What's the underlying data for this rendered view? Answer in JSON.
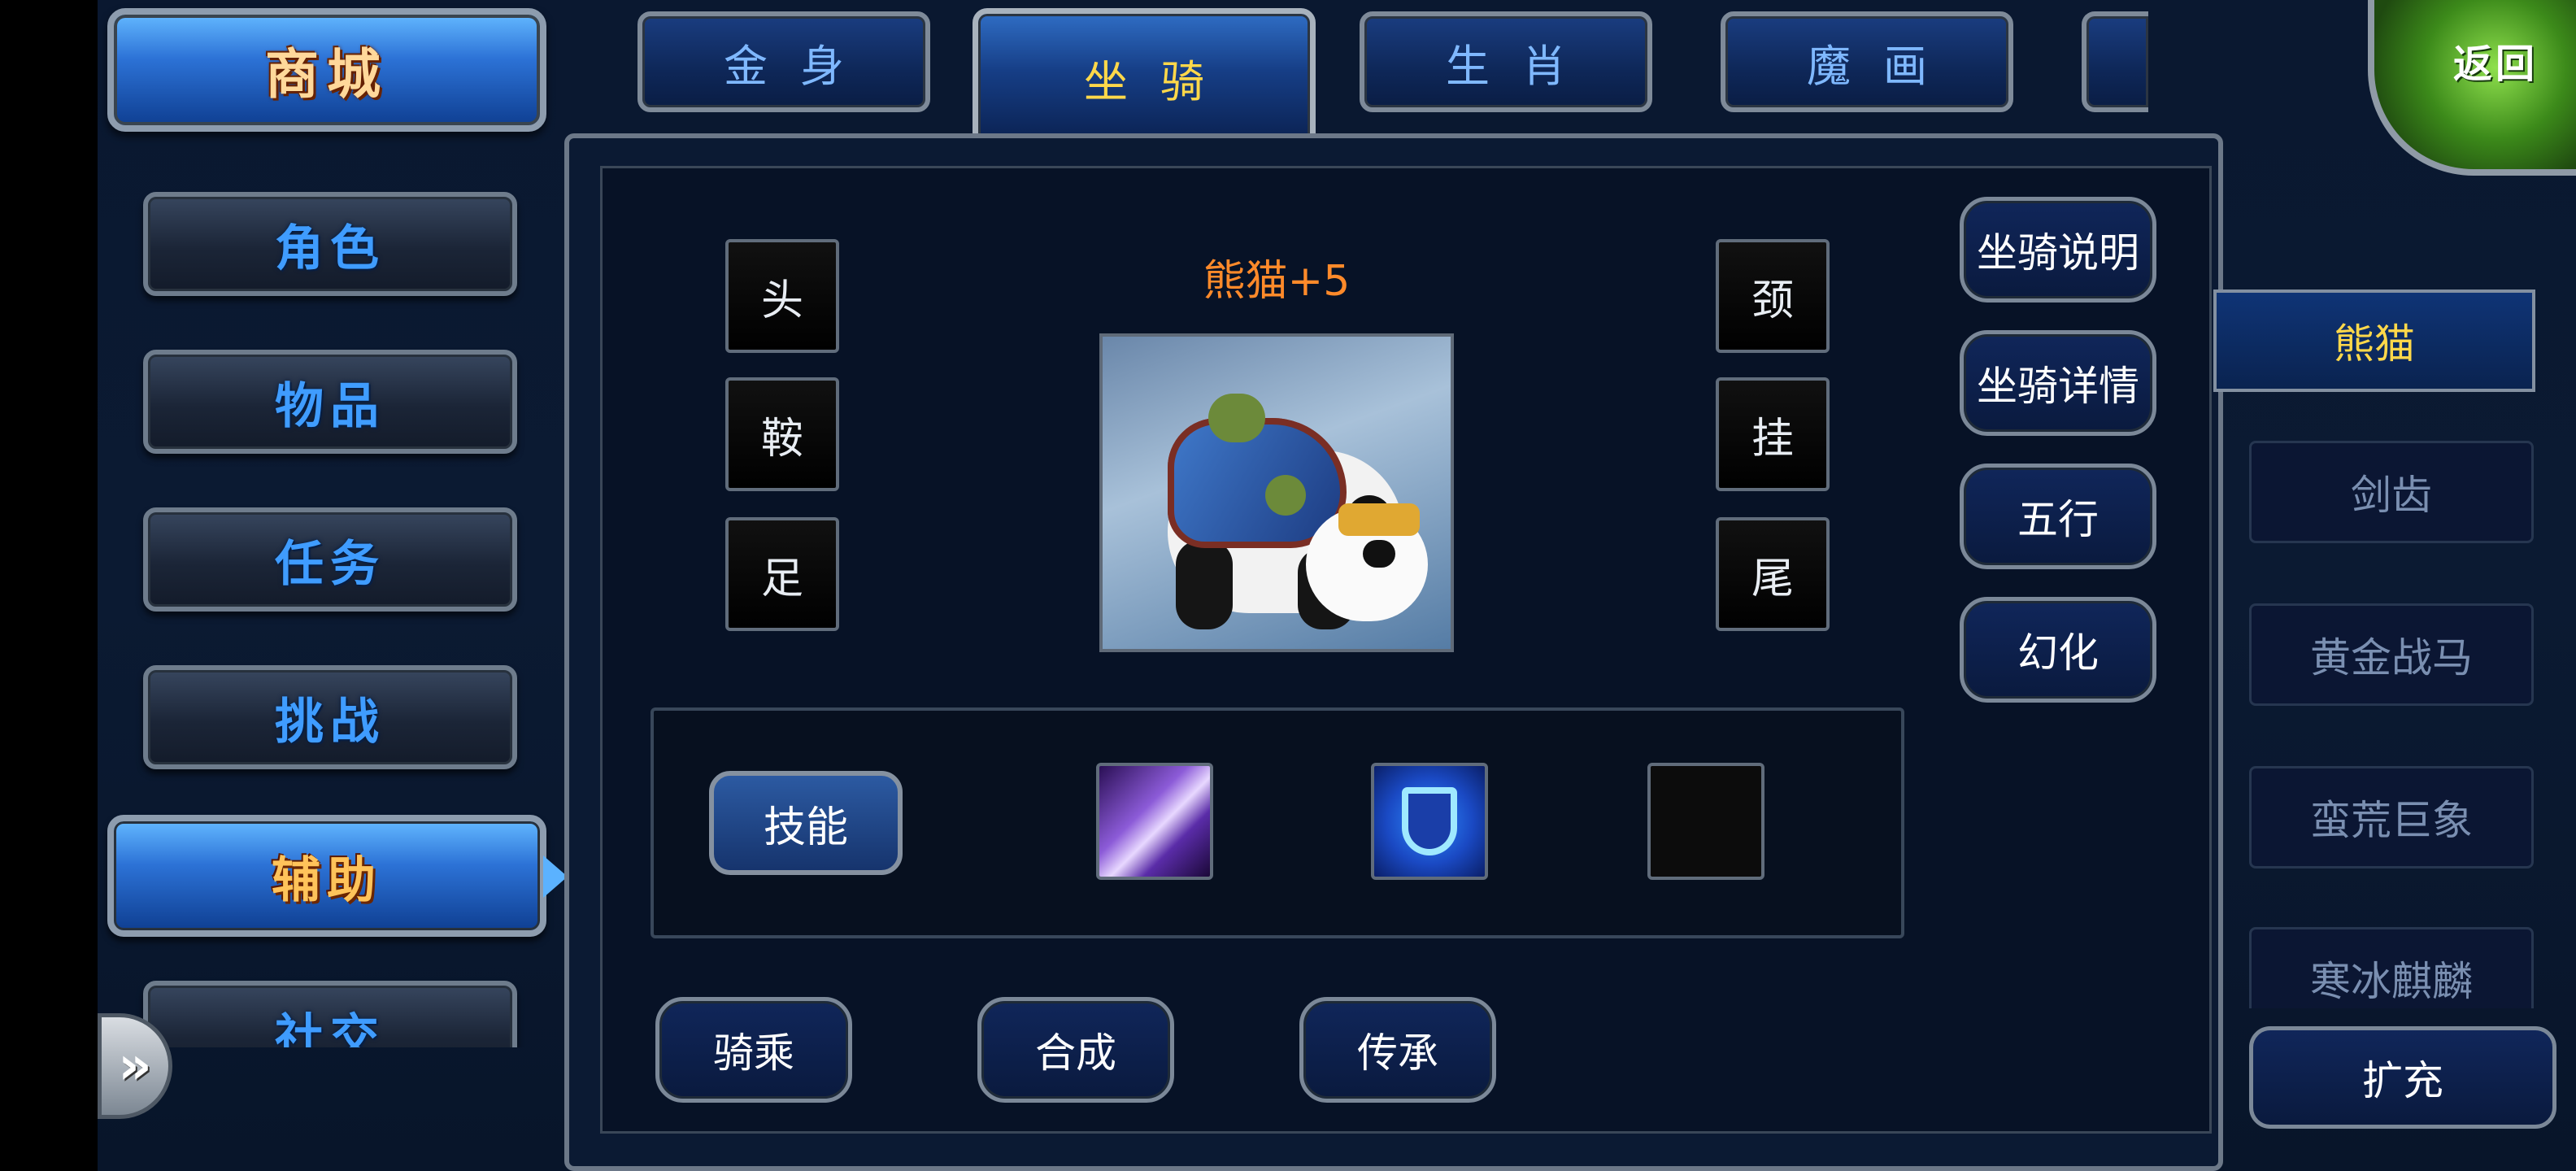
{
  "sidebar": {
    "store_label": "商城",
    "items": [
      {
        "label": "角色"
      },
      {
        "label": "物品"
      },
      {
        "label": "任务"
      },
      {
        "label": "挑战"
      },
      {
        "label": "辅助"
      },
      {
        "label": "社交"
      }
    ],
    "active_item": "辅助",
    "expand_label": "»"
  },
  "tabs": [
    {
      "label": "金身"
    },
    {
      "label": "坐骑"
    },
    {
      "label": "生肖"
    },
    {
      "label": "魔画"
    }
  ],
  "active_tab": "坐骑",
  "back_label": "返回",
  "mount": {
    "name": "熊猫+5",
    "slots_left": [
      "头",
      "鞍",
      "足"
    ],
    "slots_right": [
      "颈",
      "挂",
      "尾"
    ],
    "portrait_icon": "panda-mount-icon"
  },
  "commands": {
    "info": "坐骑说明",
    "details": "坐骑详情",
    "five_elements": "五行",
    "transform": "幻化"
  },
  "skills": {
    "button_label": "技能",
    "slots": [
      {
        "icon": "purple-blade-skill-icon"
      },
      {
        "icon": "blue-shield-skill-icon"
      },
      {
        "icon": "empty-skill-slot"
      }
    ]
  },
  "actions": {
    "ride": "骑乘",
    "combine": "合成",
    "inherit": "传承"
  },
  "mount_list": {
    "active": "熊猫",
    "items": [
      {
        "label": "剑齿"
      },
      {
        "label": "黄金战马"
      },
      {
        "label": "蛮荒巨象"
      },
      {
        "label": "寒冰麒麟"
      }
    ],
    "expand_label": "扩充"
  },
  "colors": {
    "accent_gold": "#ffd84a",
    "mount_name_orange": "#ff8a2a",
    "sidebar_text_blue": "#3f9cff",
    "back_green": "#3c8a1a"
  }
}
